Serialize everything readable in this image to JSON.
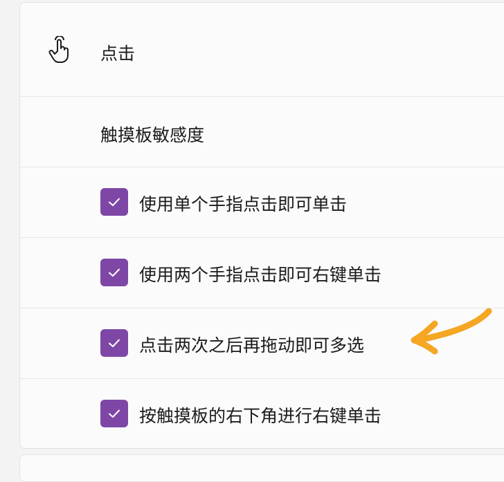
{
  "section": {
    "title": "点击",
    "icon": "hand-tap-icon"
  },
  "subheader": {
    "title": "触摸板敏感度"
  },
  "options": [
    {
      "label": "使用单个手指点击即可单击",
      "checked": true
    },
    {
      "label": "使用两个手指点击即可右键单击",
      "checked": true
    },
    {
      "label": "点击两次之后再拖动即可多选",
      "checked": true
    },
    {
      "label": "按触摸板的右下角进行右键单击",
      "checked": true
    }
  ],
  "colors": {
    "checkbox": "#7e47a6",
    "arrow": "#f5a623",
    "panel": "#fbfbfb",
    "background": "#f3f3f3"
  }
}
